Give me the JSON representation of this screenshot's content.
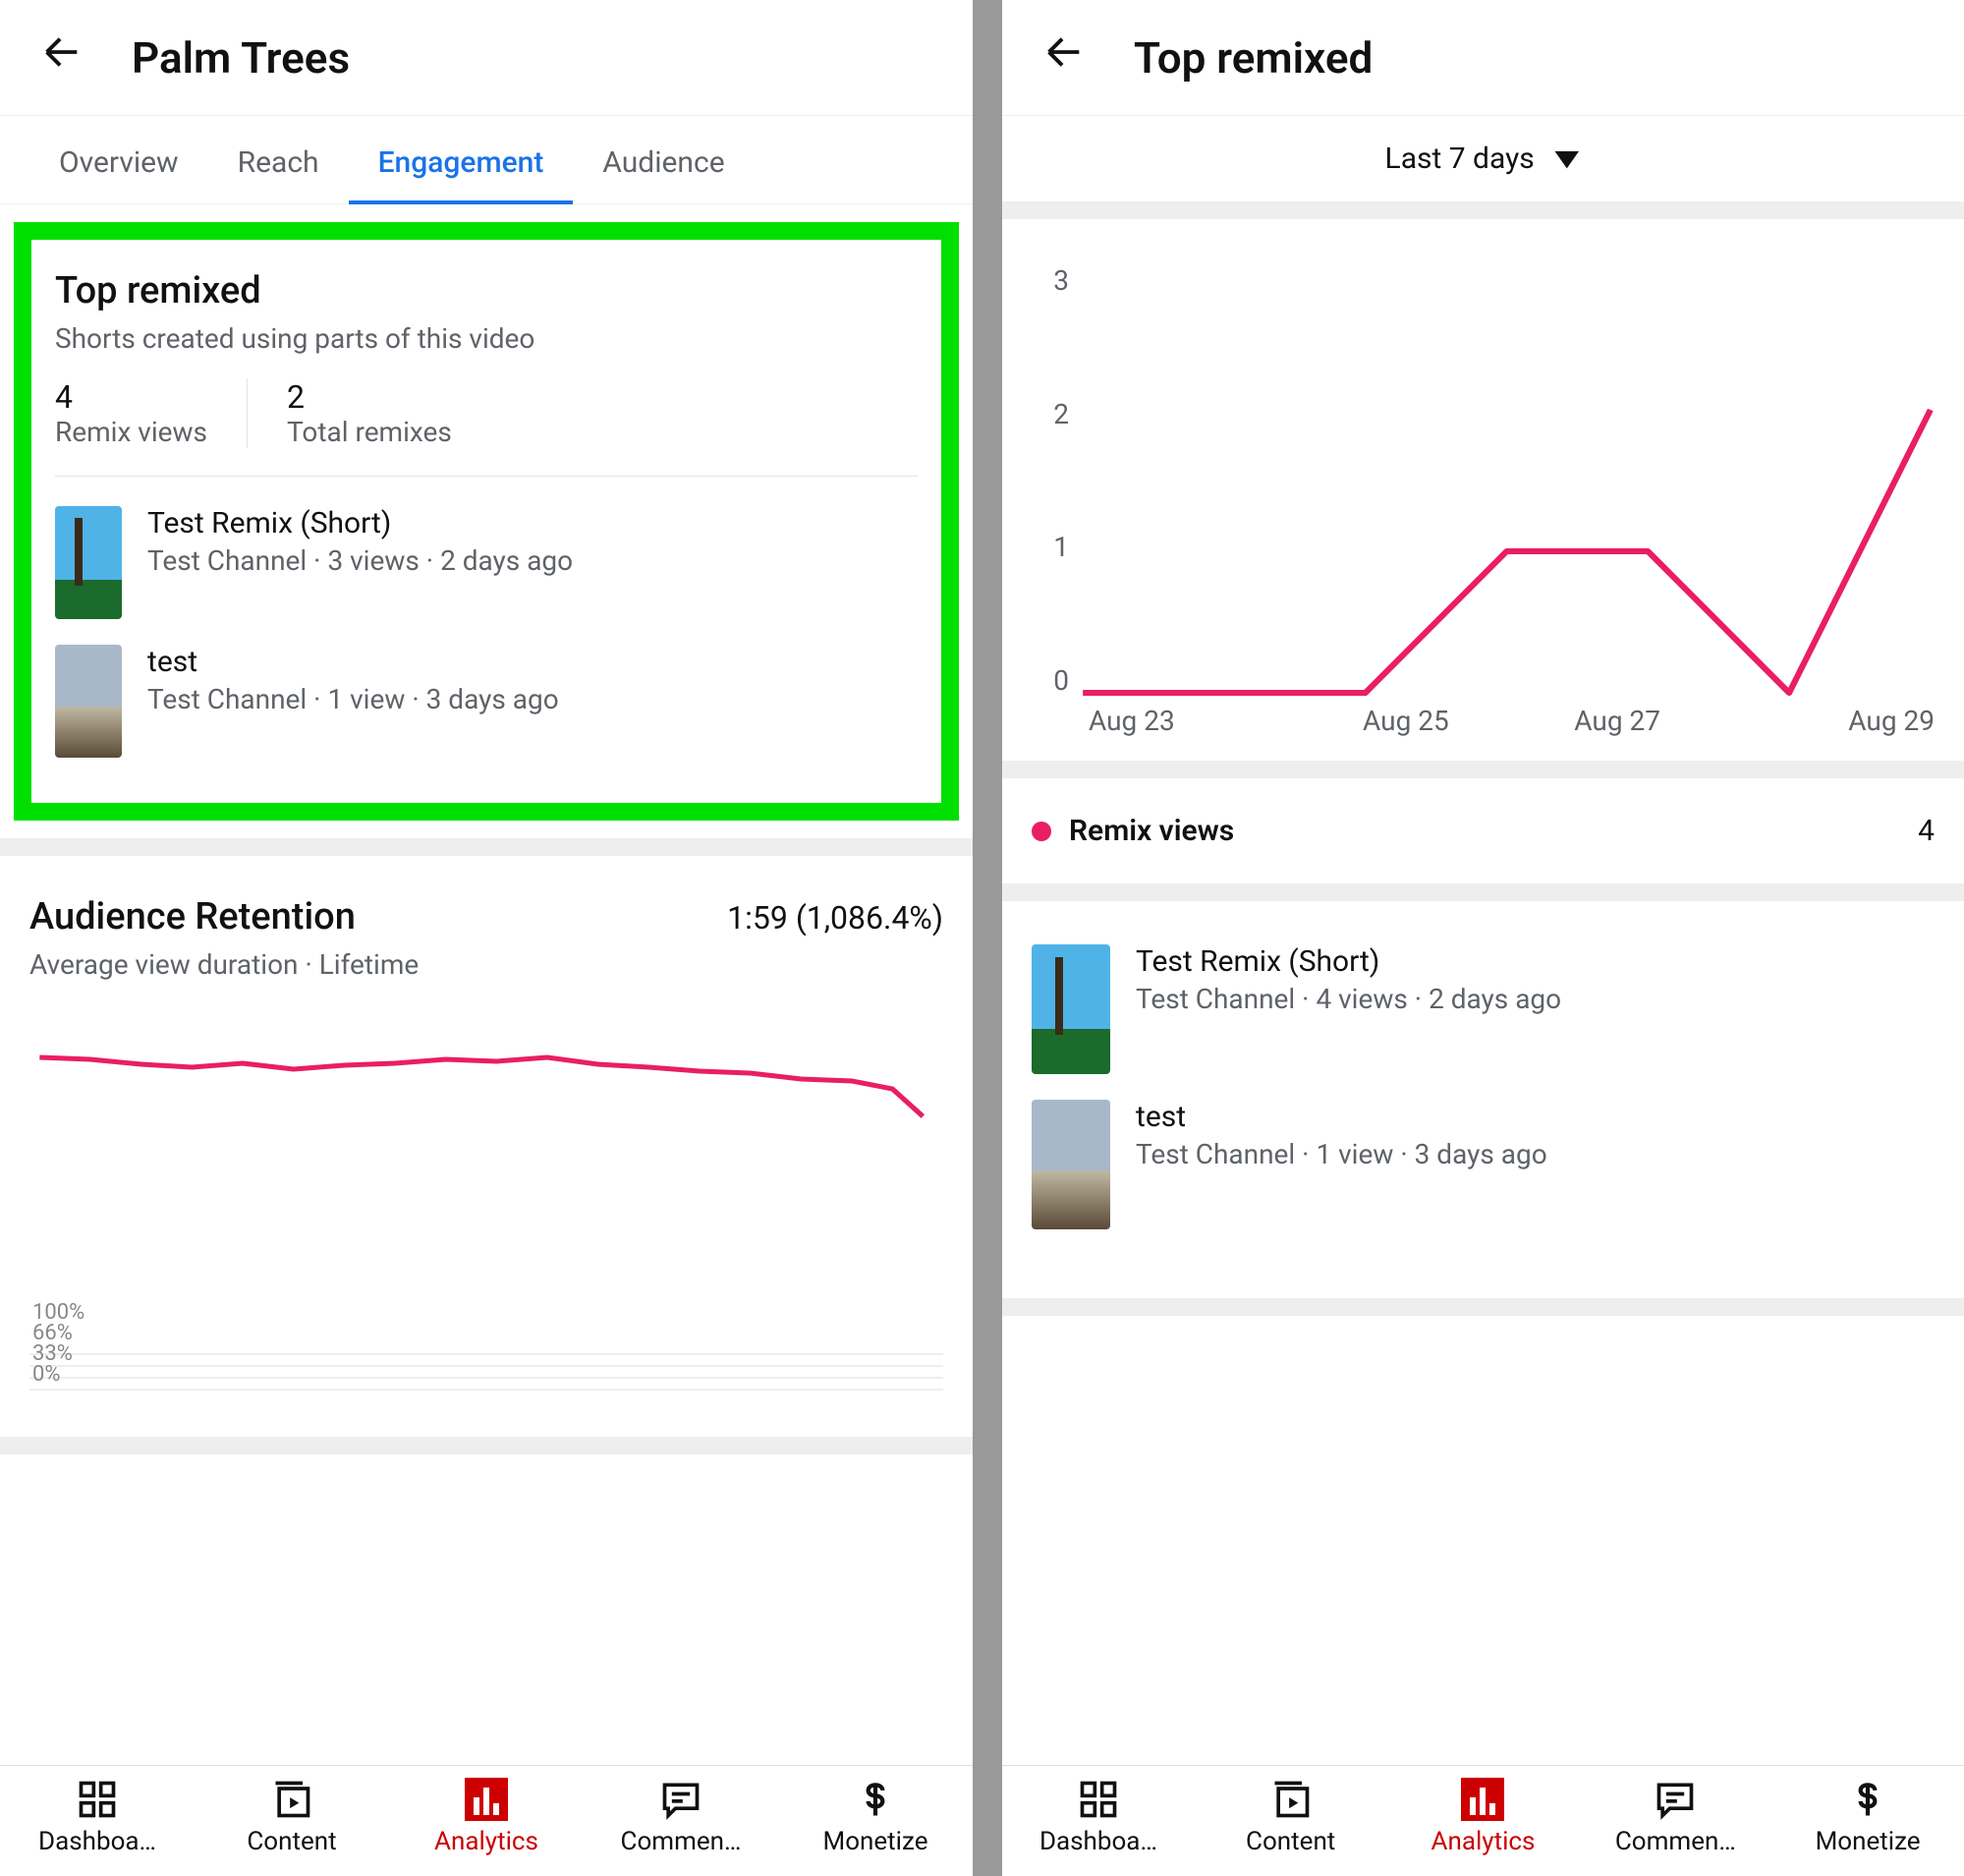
{
  "left": {
    "title": "Palm Trees",
    "tabs": [
      "Overview",
      "Reach",
      "Engagement",
      "Audience"
    ],
    "active_tab_index": 2,
    "top_remixed": {
      "title": "Top remixed",
      "subtitle": "Shorts created using parts of this video",
      "metrics": [
        {
          "value": "4",
          "label": "Remix views"
        },
        {
          "value": "2",
          "label": "Total remixes"
        }
      ],
      "items": [
        {
          "title": "Test Remix (Short)",
          "channel": "Test Channel",
          "views": "3 views",
          "age": "2 days ago",
          "thumb": "palm"
        },
        {
          "title": "test",
          "channel": "Test Channel",
          "views": "1 view",
          "age": "3 days ago",
          "thumb": "beach"
        }
      ]
    },
    "audience_retention": {
      "title": "Audience Retention",
      "value": "1:59 (1,086.4%)",
      "subtitle": "Average view duration · Lifetime",
      "y_labels": [
        "100%",
        "66%",
        "33%",
        "0%"
      ]
    }
  },
  "right": {
    "title": "Top remixed",
    "period": "Last 7 days",
    "chart_ticks_x": [
      "Aug 23",
      "Aug 25",
      "Aug 27",
      "Aug 29"
    ],
    "chart_ticks_y": [
      "3",
      "2",
      "1",
      "0"
    ],
    "legend_label": "Remix views",
    "legend_value": "4",
    "items": [
      {
        "title": "Test Remix (Short)",
        "channel": "Test Channel",
        "views": "4 views",
        "age": "2 days ago",
        "thumb": "palm"
      },
      {
        "title": "test",
        "channel": "Test Channel",
        "views": "1 view",
        "age": "3 days ago",
        "thumb": "beach"
      }
    ]
  },
  "nav": {
    "items": [
      "Dashboa…",
      "Content",
      "Analytics",
      "Commen…",
      "Monetize"
    ],
    "active_index": 2
  },
  "colors": {
    "highlight": "#00e000",
    "accent_blue": "#1a73e8",
    "accent_red": "#cc0000",
    "chart_line": "#e91e63"
  },
  "chart_data": {
    "type": "line",
    "title": "Remix views",
    "x_categories": [
      "Aug 23",
      "Aug 24",
      "Aug 25",
      "Aug 26",
      "Aug 27",
      "Aug 28",
      "Aug 29"
    ],
    "series": [
      {
        "name": "Remix views",
        "values": [
          0,
          0,
          0,
          1,
          1,
          0,
          2
        ]
      }
    ],
    "ylim": [
      0,
      3
    ],
    "xlabel": "",
    "ylabel": ""
  }
}
